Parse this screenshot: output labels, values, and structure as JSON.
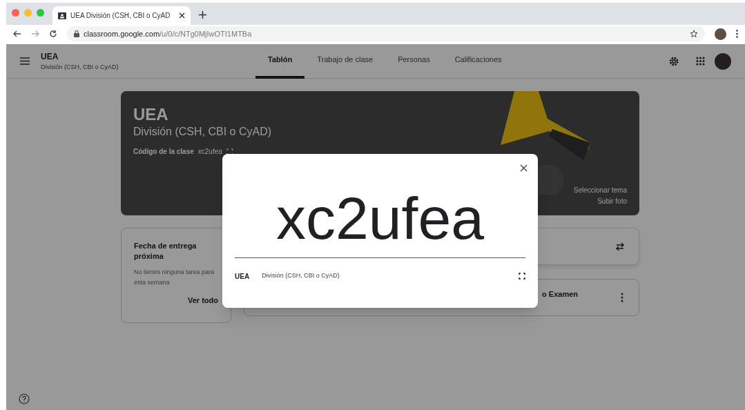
{
  "browser": {
    "tab_title": "UEA División (CSH, CBI o CyAD",
    "url_host": "classroom.google.com",
    "url_path": "/u/0/c/NTg0MjIwOTI1MTBa"
  },
  "header": {
    "title": "UEA",
    "subtitle": "División (CSH, CBI o CyAD)"
  },
  "tabs": [
    {
      "label": "Tablón",
      "selected": true
    },
    {
      "label": "Trabajo de clase",
      "selected": false
    },
    {
      "label": "Personas",
      "selected": false
    },
    {
      "label": "Calificaciones",
      "selected": false
    }
  ],
  "banner": {
    "title": "UEA",
    "subtitle": "División (CSH, CBI o CyAD)",
    "code_label": "Código de la clase",
    "code": "xc2ufea",
    "links": [
      "Seleccionar tema",
      "Subir foto"
    ]
  },
  "upcoming": {
    "title": "Fecha de entrega próxima",
    "message": "No tienes ninguna tarea para esta semana",
    "link": "Ver todo"
  },
  "stream_post": {
    "text": "o Examen"
  },
  "modal": {
    "code": "xc2ufea",
    "title": "UEA",
    "subtitle": "División (CSH, CBI o CyAD)"
  }
}
